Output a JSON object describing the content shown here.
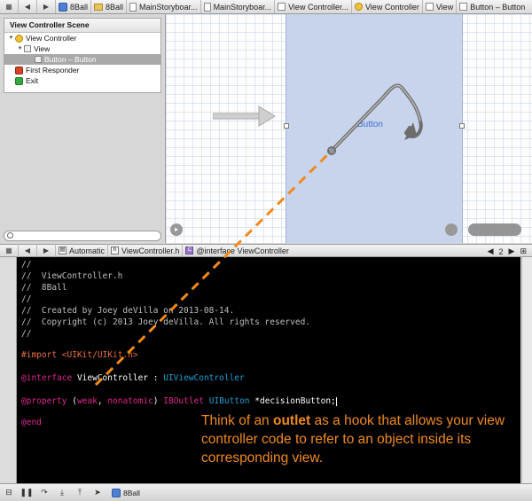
{
  "top_jumpbar": {
    "nav_left": "◀",
    "nav_right": "▶",
    "crumbs": [
      "8Ball",
      "8Ball",
      "MainStoryboar...",
      "MainStoryboar...",
      "View Controller...",
      "View Controller",
      "View",
      "Button – Button"
    ]
  },
  "outline": {
    "header": "View Controller Scene",
    "items": [
      {
        "label": "View Controller"
      },
      {
        "label": "View"
      },
      {
        "label": "Button – Button"
      },
      {
        "label": "First Responder"
      },
      {
        "label": "Exit"
      }
    ]
  },
  "canvas": {
    "button_label": "Button"
  },
  "editor_jumpbar": {
    "mode": "Automatic",
    "file": "ViewController.h",
    "symbol": "@interface ViewController",
    "counter": "2"
  },
  "code": {
    "l1": "//",
    "l2": "//  ViewController.h",
    "l3": "//  8Ball",
    "l4": "//",
    "l5": "//  Created by Joey deVilla on 2013-08-14.",
    "l6": "//  Copyright (c) 2013 Joey deVilla. All rights reserved.",
    "l7": "//",
    "import_kw": "#import",
    "import_path": "<UIKit/UIKit.h>",
    "interface_kw": "@interface",
    "class_name": "ViewController :",
    "super_class": "UIViewController",
    "property_kw": "@property",
    "attr_open": "(",
    "attr_weak": "weak",
    "attr_comma": ",",
    "attr_nonatomic": "nonatomic",
    "attr_close": ")",
    "outlet_kw": "IBOutlet",
    "outlet_type": "UIButton",
    "outlet_name": "*decisionButton;",
    "end_kw": "@end"
  },
  "callout": {
    "pre": "Think of an",
    "bold": "outlet",
    "post": "as a hook that allows your view controller code to refer to an object inside its corresponding view."
  },
  "debugbar": {
    "target": "8Ball"
  },
  "colors": {
    "callout": "#f08a1f",
    "keyword": "#e0268f",
    "type": "#1d9fd7",
    "preprocessor": "#e8703a",
    "scene_bg": "#c8d4ec"
  }
}
